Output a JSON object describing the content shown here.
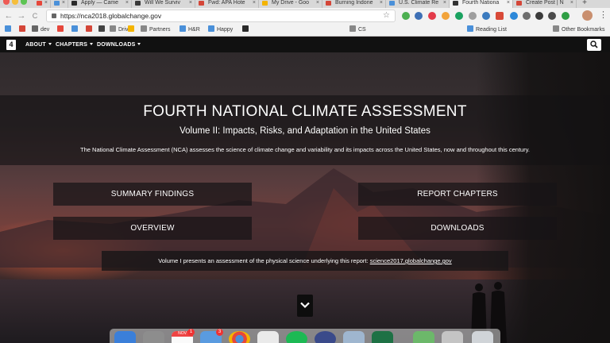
{
  "browser": {
    "tabs": [
      {
        "label": "",
        "favicon_color": "#e6473b"
      },
      {
        "label": "",
        "favicon_color": "#4a90d9"
      },
      {
        "label": "Apply — Came",
        "favicon_color": "#2a2a2a"
      },
      {
        "label": "Will We Surviv",
        "favicon_color": "#3a3a3a"
      },
      {
        "label": "Fwd: APA Hote",
        "favicon_color": "#d44638"
      },
      {
        "label": "My Drive - Goo",
        "favicon_color": "#f4b400"
      },
      {
        "label": "Burning Indone",
        "favicon_color": "#d44638"
      },
      {
        "label": "U.S. Climate Re",
        "favicon_color": "#4a90d9"
      },
      {
        "label": "Fourth Nationa",
        "favicon_color": "#333333",
        "active": true
      },
      {
        "label": "Create Post | N",
        "favicon_color": "#d44638"
      }
    ],
    "new_tab_glyph": "+",
    "back_glyph": "←",
    "forward_glyph": "→",
    "reload_glyph": "C",
    "url": "https://nca2018.globalchange.gov",
    "star_glyph": "☆",
    "menu_glyph": "⋮",
    "bookmarks": [
      {
        "label": "",
        "color": "#4a90d9"
      },
      {
        "label": "",
        "color": "#d44638"
      },
      {
        "label": "dev",
        "color": "#666666"
      },
      {
        "label": "",
        "color": "#e6473b"
      },
      {
        "label": "",
        "color": "#4a90d9"
      },
      {
        "label": "",
        "color": "#d44638"
      },
      {
        "label": "",
        "color": "#444444"
      },
      {
        "label": "Drive",
        "color": "#888888"
      },
      {
        "label": "",
        "color": "#f4b400"
      },
      {
        "label": "Partners",
        "color": "#888888"
      },
      {
        "label": "H&R",
        "color": "#4a90d9"
      },
      {
        "label": "Happy",
        "color": "#4a90d9"
      },
      {
        "label": "",
        "color": "#2a2a2a"
      },
      {
        "label": "CS",
        "color": "#888888"
      },
      {
        "label": "Reading List",
        "color": "#4a90d9"
      },
      {
        "label": "Other Bookmarks",
        "color": "#888888"
      }
    ]
  },
  "site": {
    "logo_text": "4",
    "nav": [
      {
        "label": "ABOUT"
      },
      {
        "label": "CHAPTERS"
      },
      {
        "label": "DOWNLOADS"
      }
    ],
    "title": "FOURTH NATIONAL CLIMATE ASSESSMENT",
    "subtitle": "Volume II: Impacts, Risks, and Adaptation in the United States",
    "lede": "The National Climate Assessment (NCA) assesses the science of climate change and variability and its impacts across the United States, now and throughout this century.",
    "buttons": {
      "summary": "SUMMARY FINDINGS",
      "chapters": "REPORT CHAPTERS",
      "overview": "OVERVIEW",
      "downloads": "DOWNLOADS"
    },
    "volume1_text": "Volume I presents an assessment of the physical science underlying this report: ",
    "volume1_link": "science2017.globalchange.gov"
  },
  "dock": {
    "badges": {
      "calendar": "1",
      "mail": "3"
    },
    "calendar_label": "NOV"
  },
  "colors": {
    "nav_bg": "#111111",
    "panel_bg": "rgba(22,20,22,0.72)"
  }
}
